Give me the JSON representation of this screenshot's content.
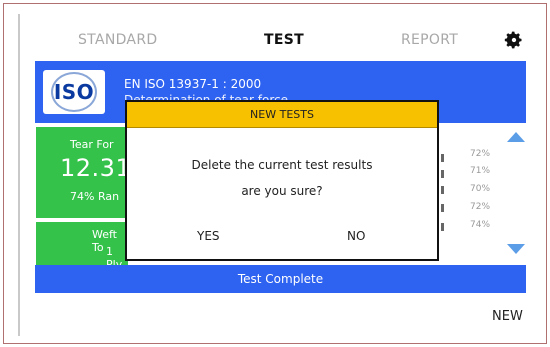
{
  "tabs": [
    "STANDARD",
    "TEST",
    "REPORT"
  ],
  "active_tab": "TEST",
  "standard": {
    "code": "EN ISO 13937-1 : 2000",
    "description": "Determination of tear force",
    "logo_text": "ISO"
  },
  "result_card": {
    "label": "Tear For",
    "value": "12.31",
    "range": "74% Ran"
  },
  "weft_card": {
    "label": "Weft To",
    "ply": "1 Ply"
  },
  "percentages": [
    "72%",
    "71%",
    "70%",
    "72%",
    "74%"
  ],
  "status": "Test Complete",
  "new_button": "NEW",
  "dialog": {
    "title": "NEW TESTS",
    "line1": "Delete the current test results",
    "line2": "are you sure?",
    "yes": "YES",
    "no": "NO"
  },
  "colors": {
    "accent_blue": "#2e62f0",
    "success_green": "#35c24a",
    "dialog_header": "#f7c100"
  }
}
